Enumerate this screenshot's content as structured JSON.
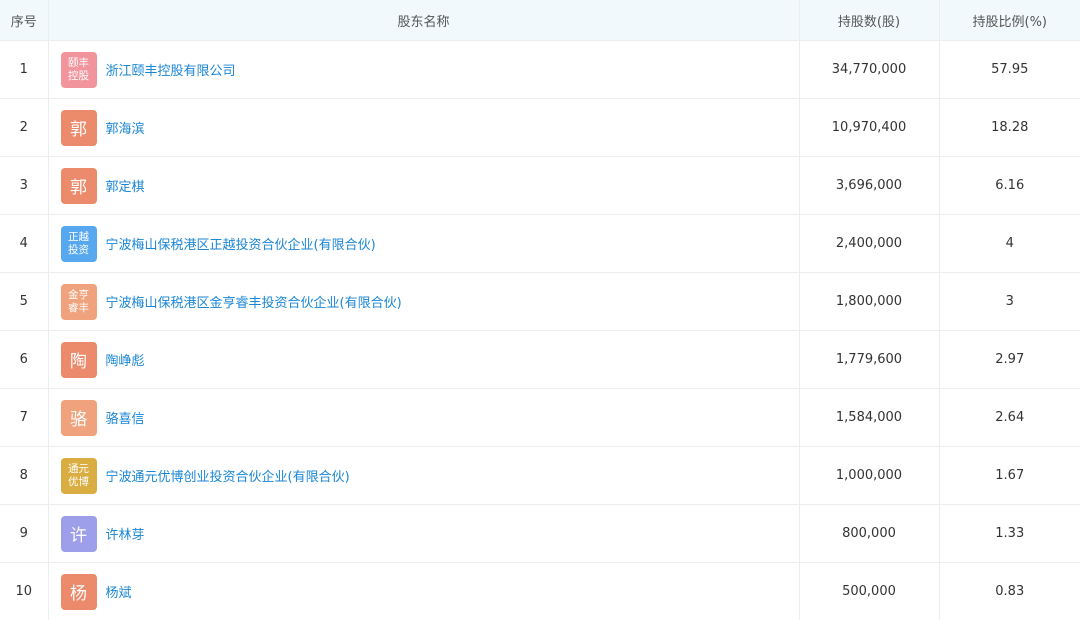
{
  "headers": {
    "index": "序号",
    "name": "股东名称",
    "shares": "持股数(股)",
    "percent": "持股比例(%)"
  },
  "rows": [
    {
      "index": "1",
      "logo": "颐丰控股",
      "name": "浙江颐丰控股有限公司",
      "shares": "34,770,000",
      "percent": "57.95",
      "logo_color": "#f2949b"
    },
    {
      "index": "2",
      "logo": "郭",
      "name": "郭海滨",
      "shares": "10,970,400",
      "percent": "18.28",
      "logo_color": "#ec8a6c"
    },
    {
      "index": "3",
      "logo": "郭",
      "name": "郭定棋",
      "shares": "3,696,000",
      "percent": "6.16",
      "logo_color": "#ec8a6c"
    },
    {
      "index": "4",
      "logo": "正越投资",
      "name": "宁波梅山保税港区正越投资合伙企业(有限合伙)",
      "shares": "2,400,000",
      "percent": "4",
      "logo_color": "#58a8f0"
    },
    {
      "index": "5",
      "logo": "金亨睿丰",
      "name": "宁波梅山保税港区金亨睿丰投资合伙企业(有限合伙)",
      "shares": "1,800,000",
      "percent": "3",
      "logo_color": "#efa27c"
    },
    {
      "index": "6",
      "logo": "陶",
      "name": "陶峥彪",
      "shares": "1,779,600",
      "percent": "2.97",
      "logo_color": "#ec8a6c"
    },
    {
      "index": "7",
      "logo": "骆",
      "name": "骆喜信",
      "shares": "1,584,000",
      "percent": "2.64",
      "logo_color": "#efa27c"
    },
    {
      "index": "8",
      "logo": "通元优博",
      "name": "宁波通元优博创业投资合伙企业(有限合伙)",
      "shares": "1,000,000",
      "percent": "1.67",
      "logo_color": "#d9ad42"
    },
    {
      "index": "9",
      "logo": "许",
      "name": "许林芽",
      "shares": "800,000",
      "percent": "1.33",
      "logo_color": "#9d9fea"
    },
    {
      "index": "10",
      "logo": "杨",
      "name": "杨斌",
      "shares": "500,000",
      "percent": "0.83",
      "logo_color": "#ec8a6c"
    }
  ]
}
